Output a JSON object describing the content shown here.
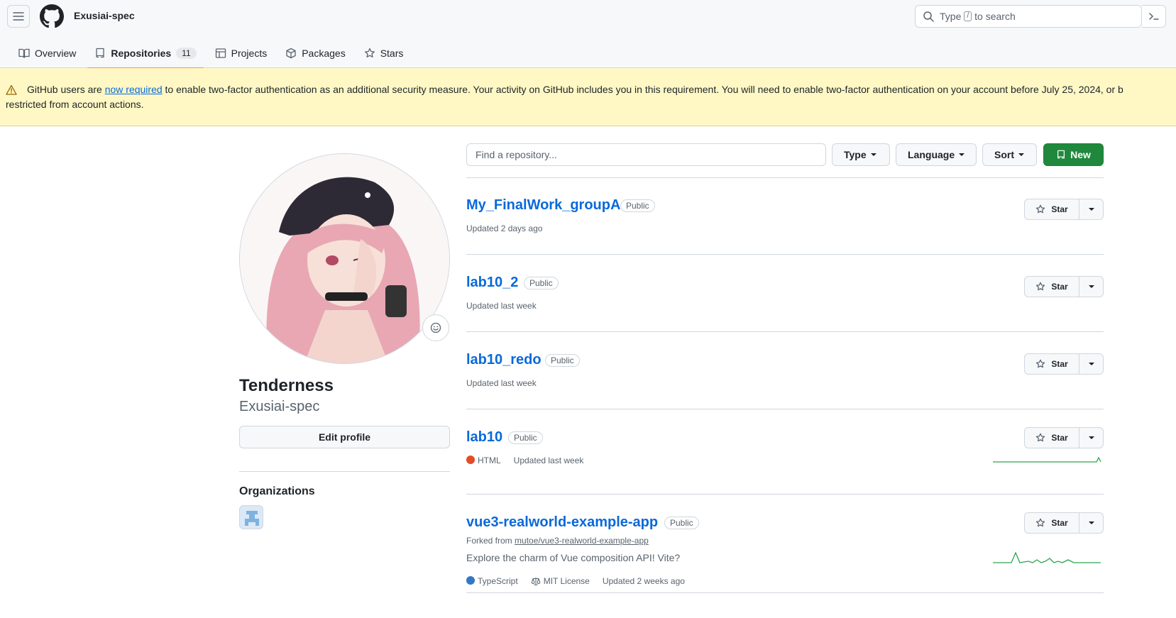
{
  "header": {
    "username": "Exusiai-spec",
    "search": {
      "prefix": "Type",
      "key": "/",
      "suffix": "to search"
    }
  },
  "nav": {
    "tabs": [
      {
        "label": "Overview",
        "icon": "book-icon"
      },
      {
        "label": "Repositories",
        "icon": "repo-icon",
        "count": "11",
        "active": true
      },
      {
        "label": "Projects",
        "icon": "table-icon"
      },
      {
        "label": "Packages",
        "icon": "package-icon"
      },
      {
        "label": "Stars",
        "icon": "star-icon"
      }
    ]
  },
  "banner": {
    "text_before": "GitHub users are",
    "link": "now required",
    "text_after": "to enable two-factor authentication as an additional security measure. Your activity on GitHub includes you in this requirement. You will need to enable two-factor authentication on your account before July 25, 2024, or b",
    "line2": "restricted from account actions."
  },
  "profile": {
    "fullname": "Tenderness",
    "username": "Exusiai-spec",
    "edit_label": "Edit profile",
    "organizations_title": "Organizations"
  },
  "toolbar": {
    "find_placeholder": "Find a repository...",
    "type_label": "Type",
    "language_label": "Language",
    "sort_label": "Sort",
    "new_label": "New"
  },
  "repos": [
    {
      "name": "My_FinalWork_groupA",
      "visibility": "Public",
      "updated": "Updated 2 days ago",
      "star_label": "Star"
    },
    {
      "name": "lab10_2",
      "visibility": "Public",
      "updated": "Updated last week",
      "star_label": "Star"
    },
    {
      "name": "lab10_redo",
      "visibility": "Public",
      "updated": "Updated last week",
      "star_label": "Star"
    },
    {
      "name": "lab10",
      "visibility": "Public",
      "language": "HTML",
      "language_color": "#e34c26",
      "updated": "Updated last week",
      "star_label": "Star"
    },
    {
      "name": "vue3-realworld-example-app",
      "visibility": "Public",
      "fork_prefix": "Forked from",
      "fork_source": "mutoe/vue3-realworld-example-app",
      "description": "Explore the charm of Vue composition API! Vite?",
      "language": "TypeScript",
      "language_color": "#3178c6",
      "license": "MIT License",
      "updated": "Updated 2 weeks ago",
      "star_label": "Star"
    }
  ],
  "colors": {
    "accent": "#0969da",
    "primary_button": "#1f883d",
    "banner_bg": "#fff8c5",
    "sparkline": "#2da44e"
  }
}
